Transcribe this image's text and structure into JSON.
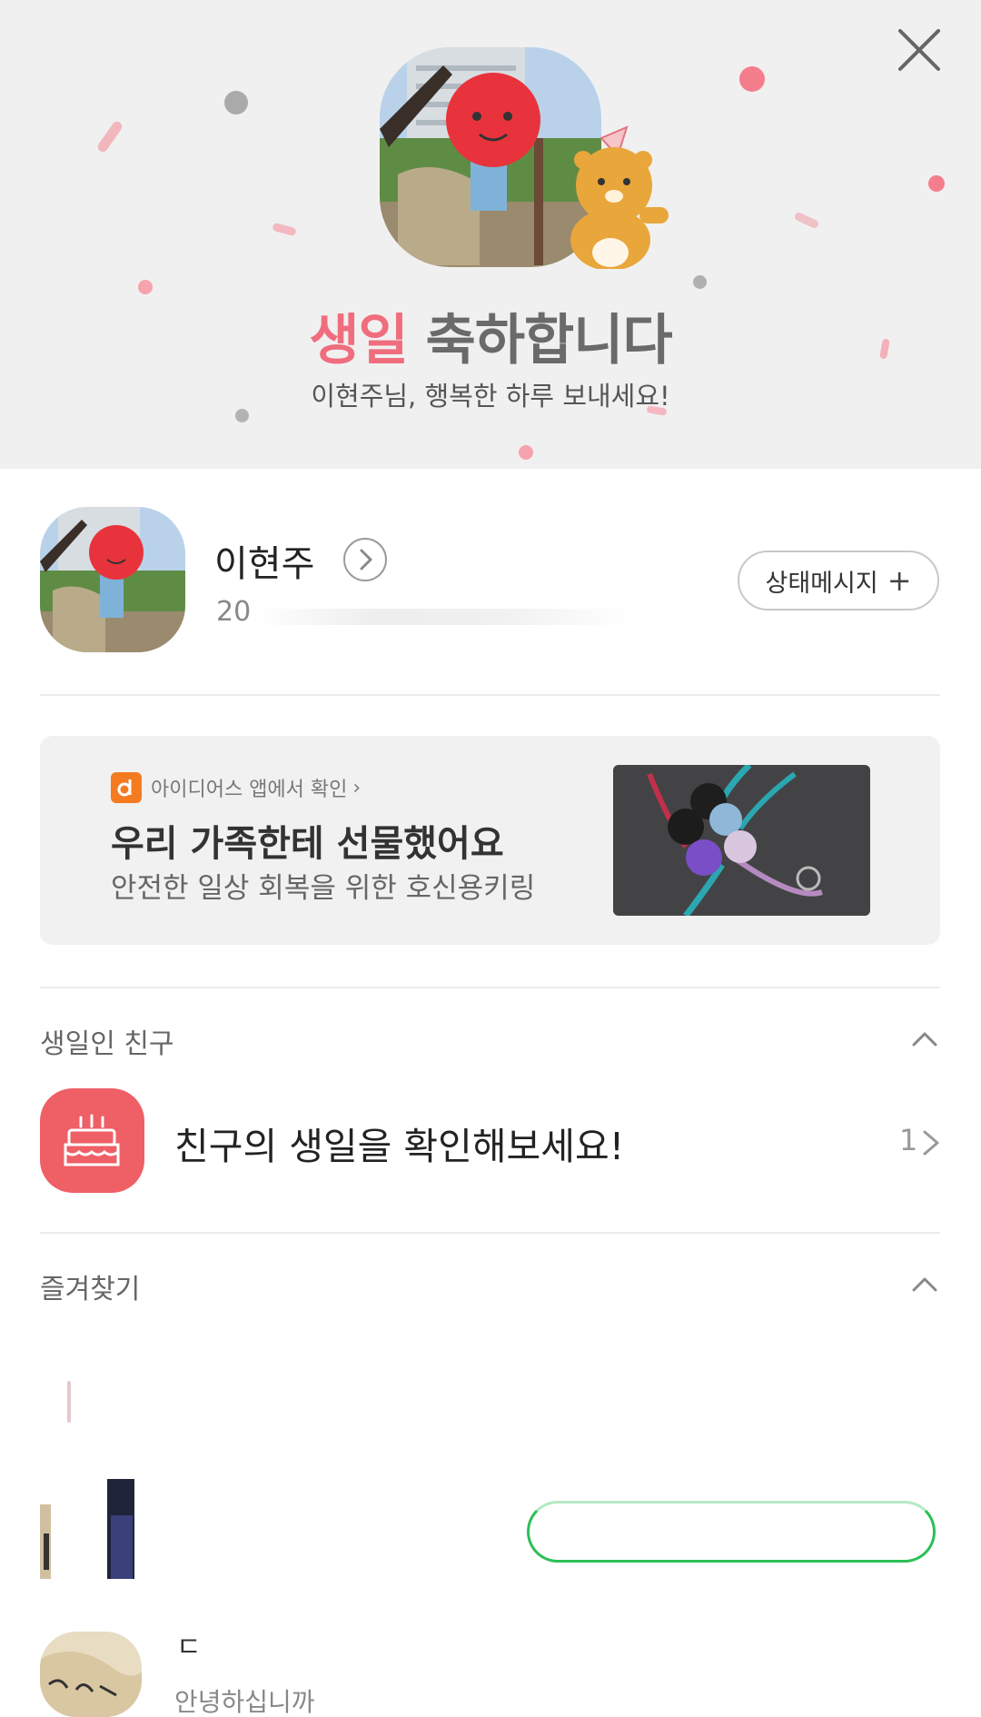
{
  "header": {
    "title_highlight": "생일",
    "title_rest": "축하합니다",
    "subtitle": "이현주님, 행복한 하루 보내세요!",
    "background": "#f0f0f0",
    "accent": "#f06d7d",
    "close_icon": "close-icon"
  },
  "profile": {
    "name": "이현주",
    "sub_visible": "20",
    "status_button_label": "상태메시지",
    "status_button_icon": "+"
  },
  "ad": {
    "source": "아이디어스 앱에서 확인",
    "source_suffix": "›",
    "source_logo": "d",
    "title": "우리 가족한테 선물했어요",
    "description": "안전한 일상 회복을 위한 호신용키링"
  },
  "birthday_section": {
    "label": "생일인 친구",
    "item_text": "친구의 생일을 확인해보세요!",
    "count": "1",
    "icon_color": "#ef5f66"
  },
  "favorites_section": {
    "label": "즐겨찾기",
    "items": [
      {
        "name": "",
        "subtitle": ""
      },
      {
        "name": "",
        "subtitle": ""
      },
      {
        "name": "ㄷ",
        "subtitle": "안녕하십니까"
      }
    ],
    "music_button_color": "#2bbf56"
  }
}
